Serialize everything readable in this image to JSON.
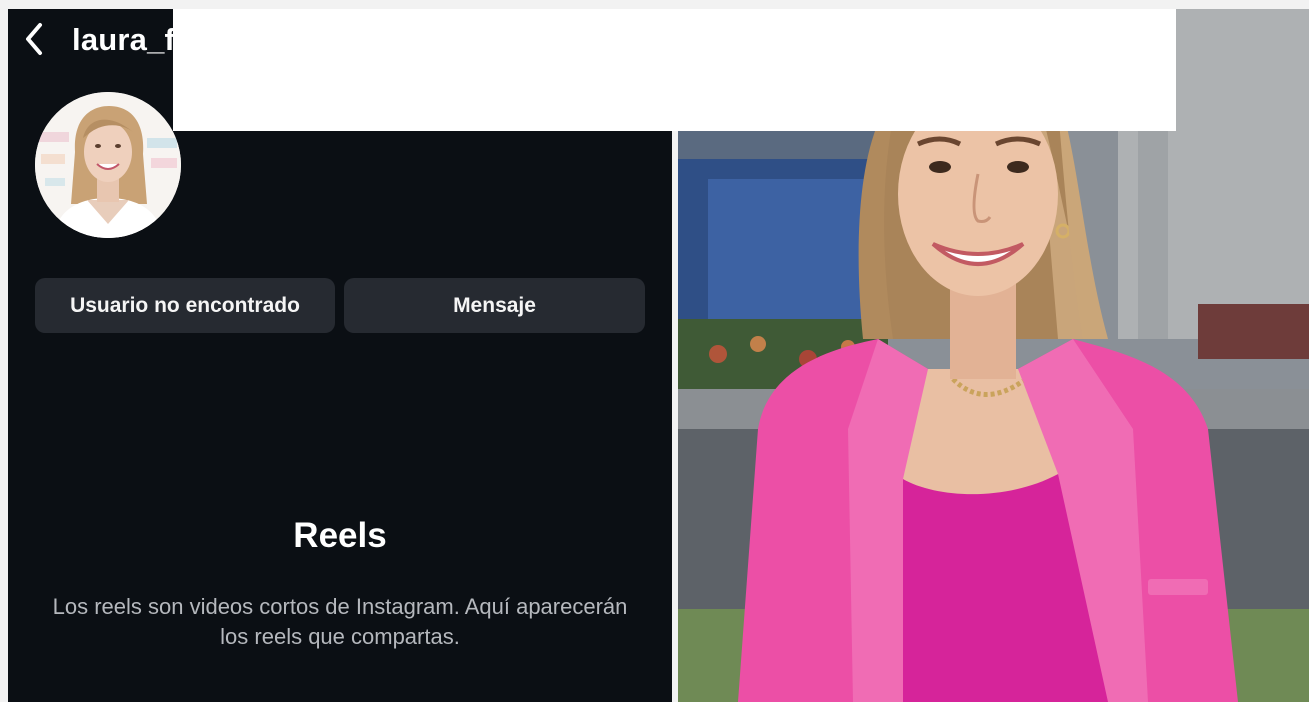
{
  "profile": {
    "username": "laura_f",
    "back_icon": "chevron-left-icon"
  },
  "buttons": {
    "user_not_found": "Usuario no encontrado",
    "message": "Mensaje"
  },
  "reels": {
    "title": "Reels",
    "description": "Los reels son videos cortos de Instagram. Aquí aparecerán los reels que compartas."
  },
  "colors": {
    "screen_background": "#0b0f14",
    "button_background": "#262a31",
    "jacket_pink": "#ec4fa6",
    "top_magenta": "#d6249a"
  }
}
